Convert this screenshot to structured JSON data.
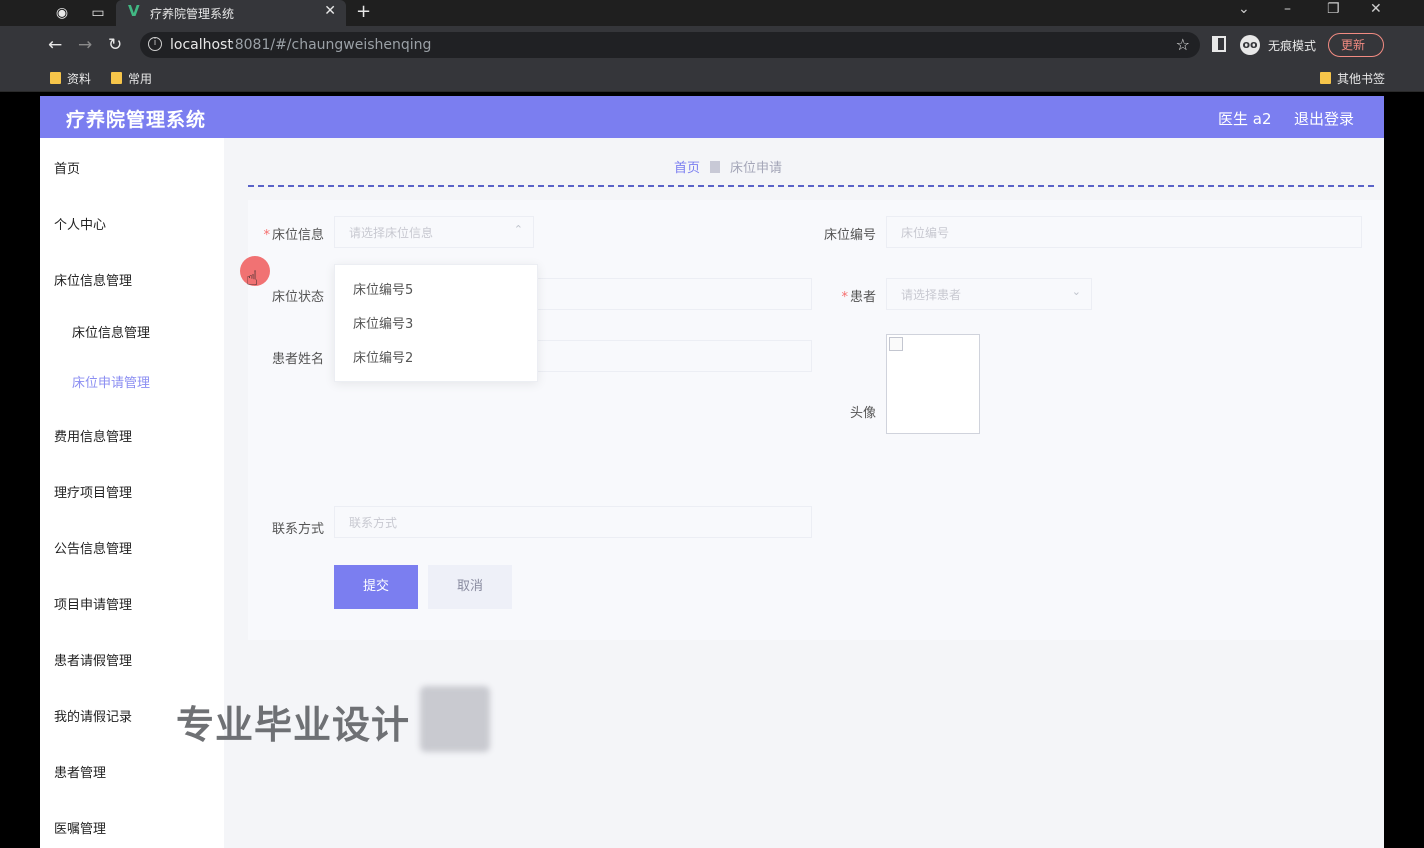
{
  "browser": {
    "tab_title": "疗养院管理系统",
    "url_host": "localhost",
    "url_rest": ":8081/#/chaungweishenqing",
    "incognito_label": "无痕模式",
    "update_label": "更新",
    "bookmarks": [
      "资料",
      "常用"
    ],
    "other_bookmarks": "其他书签"
  },
  "header": {
    "title": "疗养院管理系统",
    "user": "医生 a2",
    "logout": "退出登录"
  },
  "sidebar": {
    "items": [
      {
        "label": "首页"
      },
      {
        "label": "个人中心"
      },
      {
        "label": "床位信息管理"
      },
      {
        "label": "床位信息管理"
      },
      {
        "label": "床位申请管理"
      },
      {
        "label": "费用信息管理"
      },
      {
        "label": "理疗项目管理"
      },
      {
        "label": "公告信息管理"
      },
      {
        "label": "项目申请管理"
      },
      {
        "label": "患者请假管理"
      },
      {
        "label": "我的请假记录"
      },
      {
        "label": "患者管理"
      },
      {
        "label": "医嘱管理"
      }
    ]
  },
  "breadcrumb": {
    "home": "首页",
    "current": "床位申请"
  },
  "form": {
    "bed_info": {
      "label": "床位信息",
      "placeholder": "请选择床位信息"
    },
    "bed_number": {
      "label": "床位编号",
      "placeholder": "床位编号"
    },
    "bed_status": {
      "label": "床位状态"
    },
    "patient": {
      "label": "患者",
      "placeholder": "请选择患者"
    },
    "patient_name": {
      "label": "患者姓名"
    },
    "avatar": {
      "label": "头像"
    },
    "contact": {
      "label": "联系方式",
      "placeholder": "联系方式"
    },
    "submit": "提交",
    "cancel": "取消"
  },
  "dropdown": {
    "options": [
      "床位编号5",
      "床位编号3",
      "床位编号2"
    ]
  },
  "watermark": "专业毕业设计",
  "colors": {
    "accent": "#7b7ef0",
    "sidebar_active": "#8b8ef2",
    "cursor_highlight": "#f05a5a"
  }
}
